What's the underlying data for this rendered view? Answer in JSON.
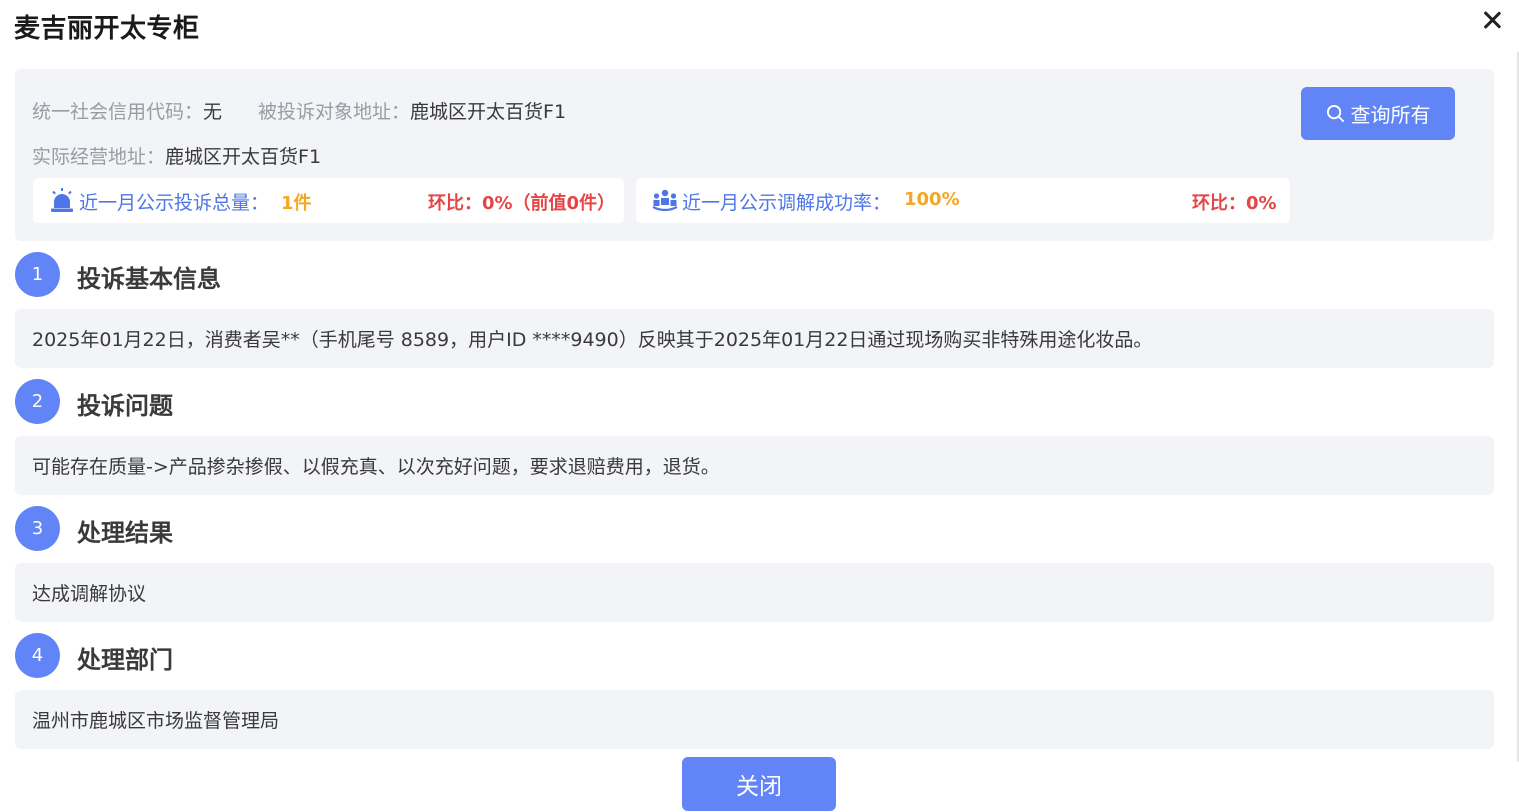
{
  "dialog": {
    "title": "麦吉丽开太专柜"
  },
  "info": {
    "credit_code_label": "统一社会信用代码：",
    "credit_code_value": "无",
    "complaint_address_label": "被投诉对象地址：",
    "complaint_address_value": "鹿城区开太百货F1",
    "actual_address_label": "实际经营地址：",
    "actual_address_value": "鹿城区开太百货F1",
    "query_all_label": "查询所有"
  },
  "stats": {
    "complaints": {
      "icon": "alarm-light-icon",
      "label": "近一月公示投诉总量：",
      "value": "1件",
      "ratio": "环比：0%（前值0件）"
    },
    "mediation": {
      "icon": "people-group-icon",
      "label": "近一月公示调解成功率：",
      "value": "100%",
      "ratio": "环比：0%"
    }
  },
  "sections": [
    {
      "number": "1",
      "title": "投诉基本信息",
      "content": "2025年01月22日，消费者吴**（手机尾号 8589，用户ID ****9490）反映其于2025年01月22日通过现场购买非特殊用途化妆品。"
    },
    {
      "number": "2",
      "title": "投诉问题",
      "content": "可能存在质量->产品掺杂掺假、以假充真、以次充好问题，要求退赔费用，退货。"
    },
    {
      "number": "3",
      "title": "处理结果",
      "content": "达成调解协议"
    },
    {
      "number": "4",
      "title": "处理部门",
      "content": "温州市鹿城区市场监督管理局"
    }
  ],
  "footer": {
    "close_label": "关闭"
  },
  "colors": {
    "accent": "#6184f7",
    "label_blue": "#4e76e8",
    "value_orange": "#f5a623",
    "ratio_red": "#e54545",
    "panel_bg": "#f3f4f8"
  }
}
